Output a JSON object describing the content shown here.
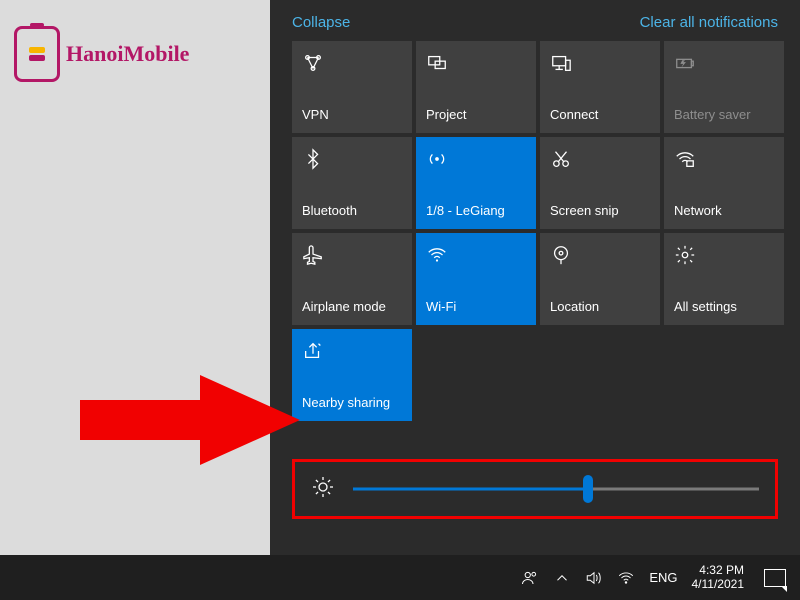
{
  "header": {
    "collapse": "Collapse",
    "clear": "Clear all notifications"
  },
  "tiles": [
    {
      "label": "VPN",
      "active": false,
      "disabled": false,
      "icon": "vpn"
    },
    {
      "label": "Project",
      "active": false,
      "disabled": false,
      "icon": "project"
    },
    {
      "label": "Connect",
      "active": false,
      "disabled": false,
      "icon": "connect"
    },
    {
      "label": "Battery saver",
      "active": false,
      "disabled": true,
      "icon": "battery"
    },
    {
      "label": "Bluetooth",
      "active": false,
      "disabled": false,
      "icon": "bluetooth"
    },
    {
      "label": "1/8 - LeGiang",
      "active": true,
      "disabled": false,
      "icon": "hotspot"
    },
    {
      "label": "Screen snip",
      "active": false,
      "disabled": false,
      "icon": "snip"
    },
    {
      "label": "Network",
      "active": false,
      "disabled": false,
      "icon": "network"
    },
    {
      "label": "Airplane mode",
      "active": false,
      "disabled": false,
      "icon": "airplane"
    },
    {
      "label": "Wi-Fi",
      "active": true,
      "disabled": false,
      "icon": "wifi"
    },
    {
      "label": "Location",
      "active": false,
      "disabled": false,
      "icon": "location"
    },
    {
      "label": "All settings",
      "active": false,
      "disabled": false,
      "icon": "settings"
    },
    {
      "label": "Nearby sharing",
      "active": true,
      "disabled": false,
      "icon": "share"
    }
  ],
  "brightness": {
    "value": 58
  },
  "taskbar": {
    "lang": "ENG",
    "time": "4:32 PM",
    "date": "4/11/2021"
  },
  "logo": {
    "text": "HanoiMobile"
  },
  "colors": {
    "accent": "#0078d7",
    "highlight": "#f10101"
  }
}
